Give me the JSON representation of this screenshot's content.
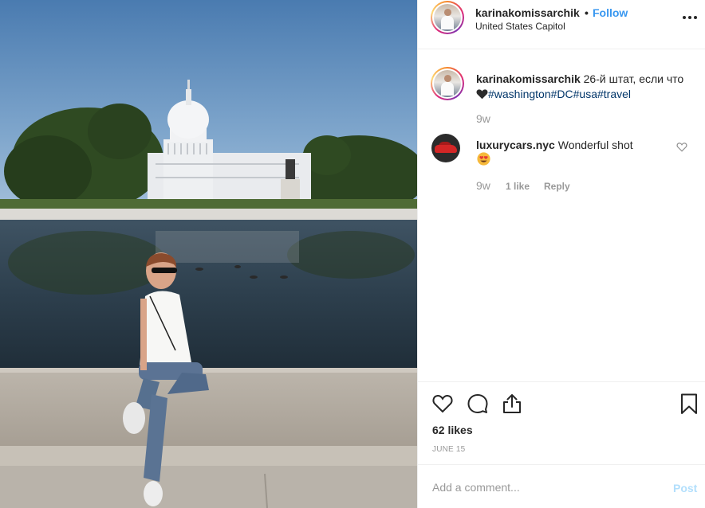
{
  "post": {
    "username": "karinakomissarchik",
    "separator": "•",
    "follow_label": "Follow",
    "location": "United States Capitol"
  },
  "caption": {
    "username": "karinakomissarchik",
    "text_before": " 26-й штат, если что",
    "tags": [
      "#washington",
      "#DC",
      "#usa",
      "#travel"
    ],
    "time": "9w"
  },
  "comment": {
    "username": "luxurycars.nyc",
    "text": " Wonderful shot",
    "time": "9w",
    "likes": "1 like",
    "reply_label": "Reply"
  },
  "actions": {
    "likes_count": "62 likes",
    "date": "JUNE 15"
  },
  "add_comment": {
    "placeholder": "Add a comment...",
    "post_label": "Post"
  },
  "icons": {
    "more": "more-options-icon",
    "like": "heart-outline-icon",
    "comment": "comment-bubble-icon",
    "share": "share-icon",
    "save": "bookmark-icon"
  },
  "colors": {
    "link_blue": "#3897f0",
    "hashtag": "#003569",
    "muted": "#999999",
    "post_disabled": "#b2dffc"
  }
}
